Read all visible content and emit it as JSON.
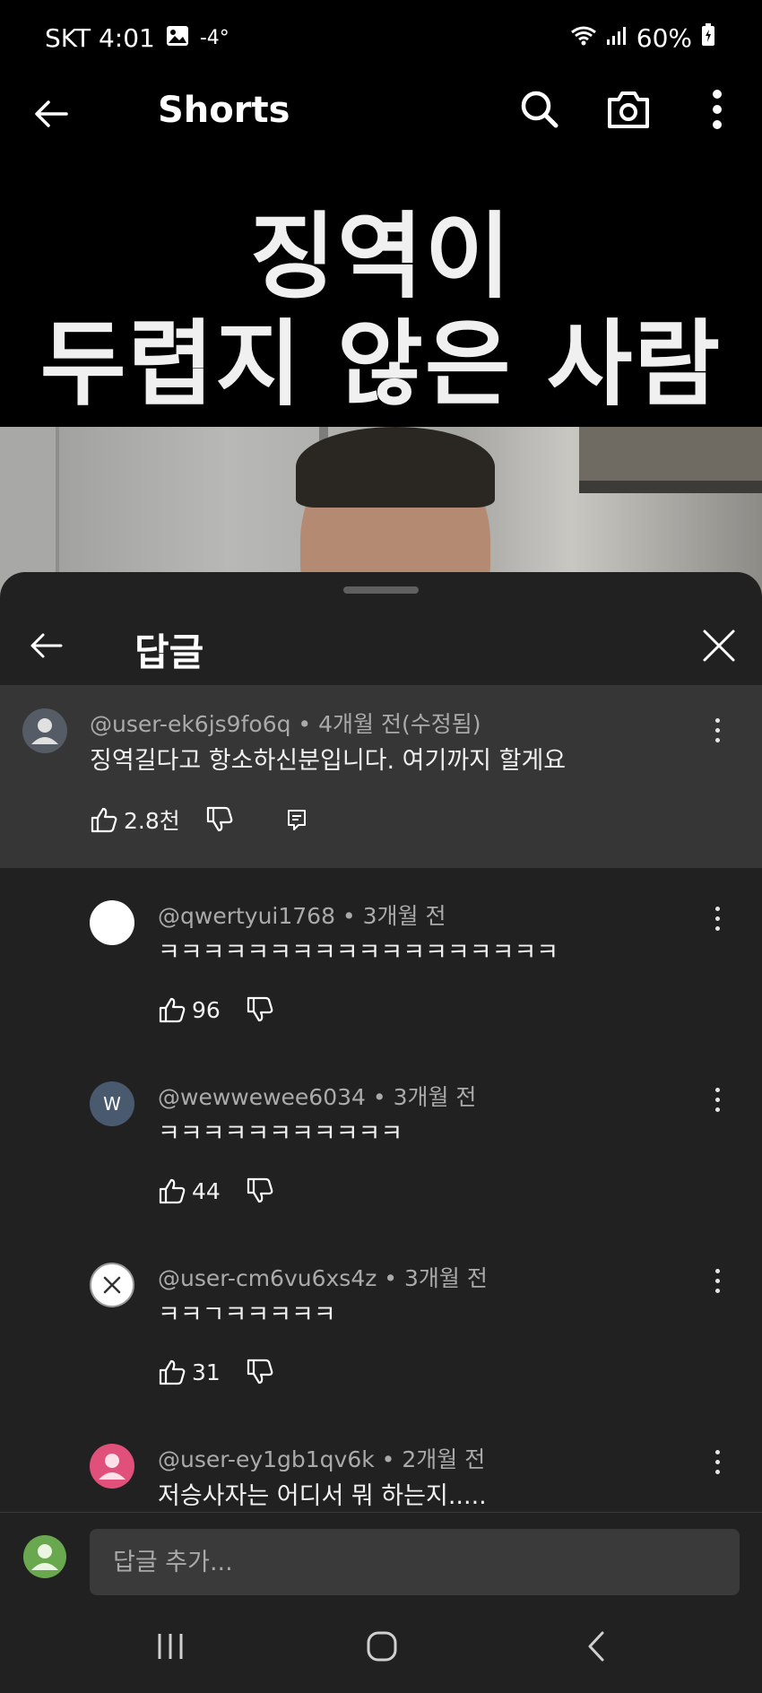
{
  "status_bar": {
    "carrier_time": "SKT 4:01",
    "temperature": "-4°",
    "battery": "60%"
  },
  "app_bar": {
    "title": "Shorts"
  },
  "video": {
    "caption_line1": "징역이",
    "caption_line2": "두렵지 않은 사람"
  },
  "sheet": {
    "title": "답글"
  },
  "parent_comment": {
    "meta": "@user-ek6js9fo6q • 4개월 전(수정됨)",
    "text": "징역길다고 항소하신분입니다. 여기까지 할게요",
    "likes": "2.8천"
  },
  "replies": [
    {
      "meta": "@qwertyui1768 • 3개월 전",
      "text": "ㅋㅋㅋㅋㅋㅋㅋㅋㅋㅋㅋㅋㅋㅋㅋㅋㅋㅋ",
      "likes": "96",
      "avatar": "white-circle"
    },
    {
      "meta": "@wewwewee6034 • 3개월 전",
      "text": "ㅋㅋㅋㅋㅋㅋㅋㅋㅋㅋㅋ",
      "likes": "44",
      "avatar_letter": "W",
      "avatar_color": "#4a5a6e"
    },
    {
      "meta": "@user-cm6vu6xs4z • 3개월 전",
      "text": "ㅋㅋㄱㅋㅋㅋㅋㅋ",
      "likes": "31",
      "avatar": "x-circle"
    },
    {
      "meta": "@user-ey1gb1qv6k • 2개월 전",
      "text": "저승사자는 어디서 뭐 하는지.....",
      "avatar_color": "#e0507a"
    }
  ],
  "input": {
    "placeholder": "답글 추가..."
  },
  "colors": {
    "sheet_bg": "#212121",
    "highlight_bg": "#363636",
    "meta_text": "#aaaaaa"
  }
}
